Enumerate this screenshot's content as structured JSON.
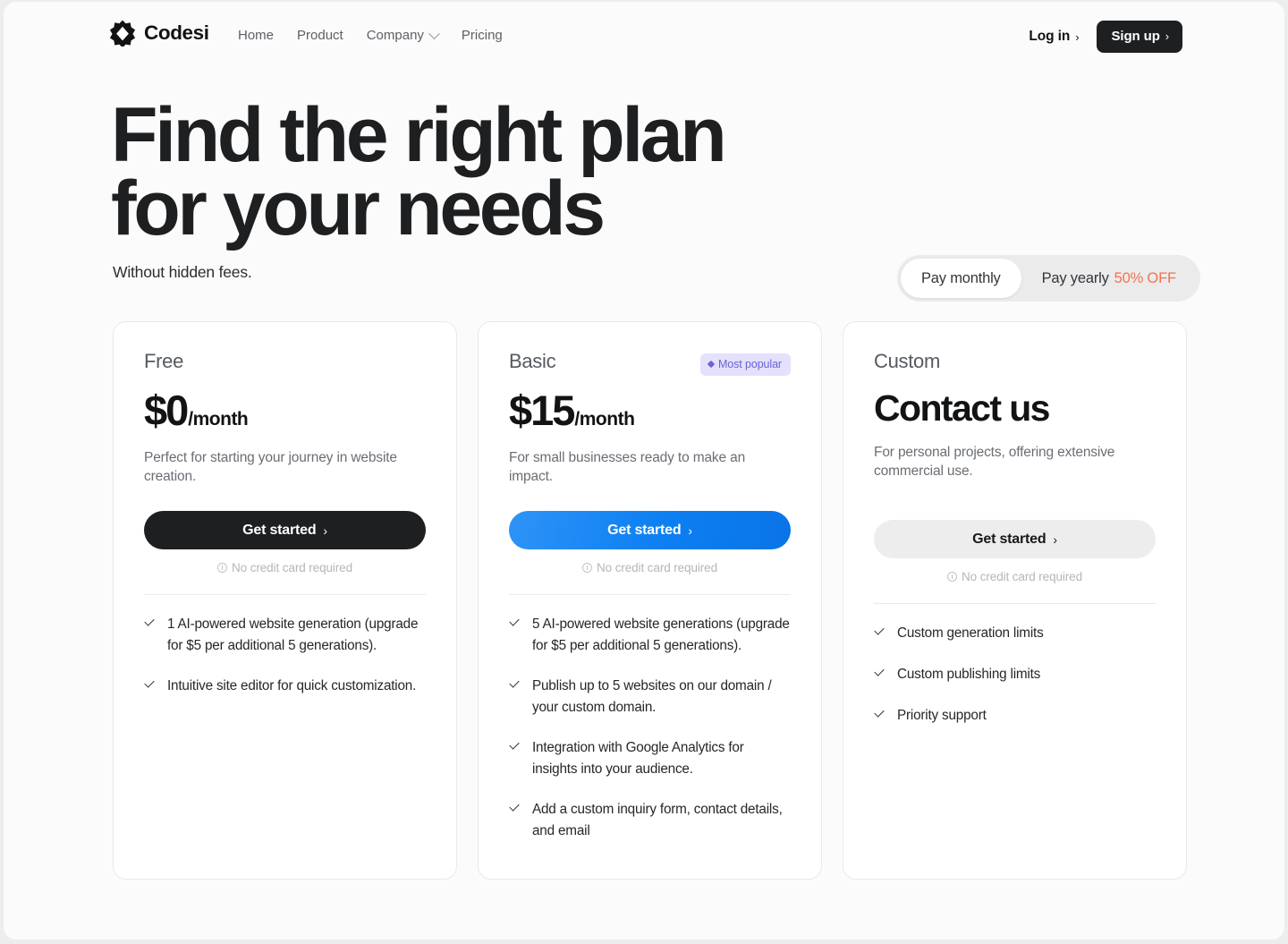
{
  "brand": {
    "name": "Codesi",
    "logo_icon": "codesi-star-logo"
  },
  "nav": {
    "links": [
      {
        "label": "Home",
        "has_dropdown": false
      },
      {
        "label": "Product",
        "has_dropdown": false
      },
      {
        "label": "Company",
        "has_dropdown": true
      },
      {
        "label": "Pricing",
        "has_dropdown": false
      }
    ],
    "login_label": "Log in",
    "signup_label": "Sign up",
    "arrow": "›"
  },
  "hero": {
    "title_line1": "Find the right plan",
    "title_line2": "for your needs",
    "subtitle": "Without hidden fees."
  },
  "billing": {
    "monthly_label": "Pay monthly",
    "yearly_label": "Pay yearly",
    "yearly_discount": "50% OFF",
    "selected": "monthly",
    "discount_color": "#f4724a"
  },
  "no_credit_card_text": "No credit card required",
  "plans": [
    {
      "name": "Free",
      "price_main": "$0",
      "price_period": "/month",
      "is_contact": false,
      "badge": null,
      "description": "Perfect for starting your journey in website creation.",
      "cta_label": "Get started",
      "cta_style": "dark",
      "cta_color": "#1d1f21",
      "features": [
        "1 AI-powered website generation (upgrade for $5 per additional 5 generations).",
        "Intuitive site editor for quick customization."
      ]
    },
    {
      "name": "Basic",
      "price_main": "$15",
      "price_period": "/month",
      "is_contact": false,
      "badge": "Most popular",
      "badge_color": "#6c62d6",
      "badge_bg": "#e3e1fb",
      "description": "For small businesses ready to make an impact.",
      "cta_label": "Get started",
      "cta_style": "blue",
      "cta_color": "#0c7ff2",
      "features": [
        "5 AI-powered website generations (upgrade for $5 per additional 5 generations).",
        "Publish up to 5 websites on our domain / your custom domain.",
        "Integration with Google Analytics for insights into your audience.",
        "Add a custom inquiry form, contact details, and email"
      ]
    },
    {
      "name": "Custom",
      "price_main": "Contact us",
      "price_period": "",
      "is_contact": true,
      "badge": null,
      "description": "For personal projects, offering extensive commercial use.",
      "cta_label": "Get started",
      "cta_style": "grey",
      "cta_color": "#ededee",
      "features": [
        "Custom generation limits",
        "Custom publishing limits",
        "Priority support"
      ]
    }
  ]
}
